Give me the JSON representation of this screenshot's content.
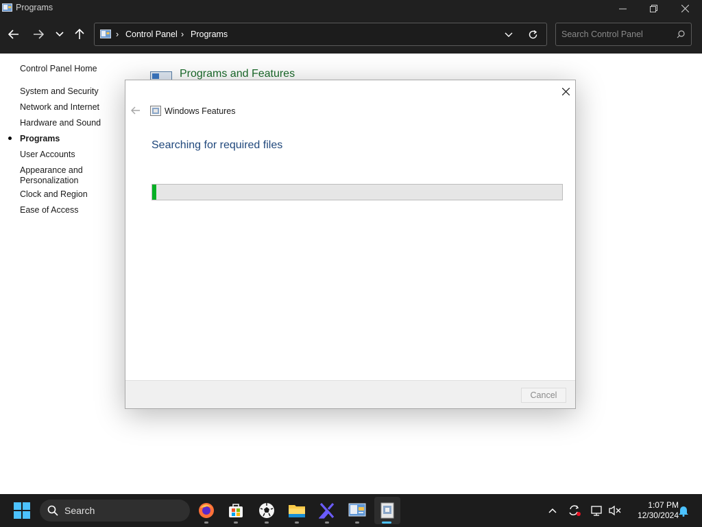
{
  "window": {
    "title": "Programs"
  },
  "breadcrumb": [
    "Control Panel",
    "Programs"
  ],
  "search": {
    "placeholder": "Search Control Panel"
  },
  "leftnav": {
    "home": "Control Panel Home",
    "items": [
      {
        "label": "System and Security"
      },
      {
        "label": "Network and Internet"
      },
      {
        "label": "Hardware and Sound"
      },
      {
        "label": "Programs",
        "active": true
      },
      {
        "label": "User Accounts"
      },
      {
        "label": "Appearance and",
        "label2": "Personalization"
      },
      {
        "label": "Clock and Region"
      },
      {
        "label": "Ease of Access"
      }
    ]
  },
  "content": {
    "section_title": "Programs and Features"
  },
  "dialog": {
    "title": "Windows Features",
    "heading": "Searching for required files",
    "progress": 0.01,
    "cancel_label": "Cancel"
  },
  "taskbar": {
    "search_label": "Search",
    "time": "1:07 PM",
    "date": "12/30/2024"
  },
  "colors": {
    "progress": "#06b025",
    "heading": "#20487c",
    "section_title": "#1a6b2a"
  }
}
